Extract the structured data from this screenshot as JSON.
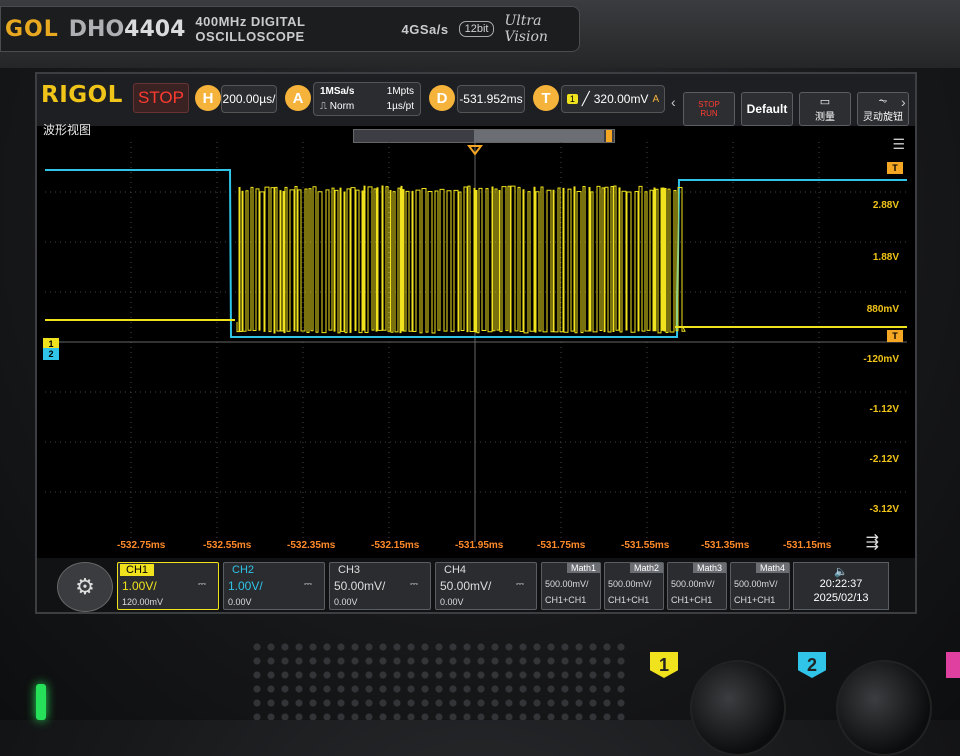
{
  "bezel": {
    "brand": "GOL",
    "model_prefix": "DHO",
    "model_num": "4404",
    "spec": "400MHz  DIGITAL OSCILLOSCOPE",
    "sample_rate": "4GSa/s",
    "bits": "12bit",
    "ultravision": "Ultra Vision"
  },
  "toolbar": {
    "logo": "RIGOL",
    "run_state": "STOP",
    "h_label": "H",
    "h_value": "200.00µs/",
    "a_label": "A",
    "acq_rate": "1MSa/s",
    "acq_points": "1Mpts",
    "acq_mode": "Norm",
    "acq_interval": "1µs/pt",
    "d_label": "D",
    "d_value": "-531.952ms",
    "t_label": "T",
    "trig_ch": "1",
    "trig_level": "320.00mV",
    "trig_mode": "A",
    "stop_run_top": "STOP",
    "stop_run_bottom": "RUN",
    "default_btn": "Default",
    "measure_btn": "测量",
    "rotary_btn": "灵动旋钮"
  },
  "view": {
    "title": "波形视图",
    "menu_icon": "menu-icon"
  },
  "axis": {
    "voltage_labels": [
      "2.88V",
      "1.88V",
      "880mV",
      "-120mV",
      "-1.12V",
      "-2.12V",
      "-3.12V"
    ],
    "time_labels": [
      "-532.75ms",
      "-532.55ms",
      "-532.35ms",
      "-532.15ms",
      "-531.95ms",
      "-531.75ms",
      "-531.55ms",
      "-531.35ms",
      "-531.15ms"
    ]
  },
  "markers": {
    "trigger_top": "T",
    "trigger_level": "T",
    "ch1": "1",
    "ch2": "2"
  },
  "channels": [
    {
      "name": "CH1",
      "scale": "1.00V/",
      "offset": "120.00mV",
      "coupling": "DC",
      "color": "#f0e21d"
    },
    {
      "name": "CH2",
      "scale": "1.00V/",
      "offset": "0.00V",
      "coupling": "DC",
      "color": "#2fc4e8"
    },
    {
      "name": "CH3",
      "scale": "50.00mV/",
      "offset": "0.00V",
      "coupling": "DC",
      "color": "#ffffff"
    },
    {
      "name": "CH4",
      "scale": "50.00mV/",
      "offset": "0.00V",
      "coupling": "DC",
      "color": "#ffffff"
    }
  ],
  "math": [
    {
      "name": "Math1",
      "value": "500.00mV/",
      "expr": "CH1+CH1"
    },
    {
      "name": "Math2",
      "value": "500.00mV/",
      "expr": "CH1+CH1"
    },
    {
      "name": "Math3",
      "value": "500.00mV/",
      "expr": "CH1+CH1"
    },
    {
      "name": "Math4",
      "value": "500.00mV/",
      "expr": "CH1+CH1"
    }
  ],
  "clock": {
    "time": "20:22:37",
    "date": "2025/02/13"
  },
  "panel": {
    "knob1_label": "1",
    "knob2_label": "2"
  },
  "colors": {
    "ch1": "#f0e21d",
    "ch2": "#2fc4e8",
    "accent": "#f5b33c",
    "stop": "#ff3b30"
  }
}
